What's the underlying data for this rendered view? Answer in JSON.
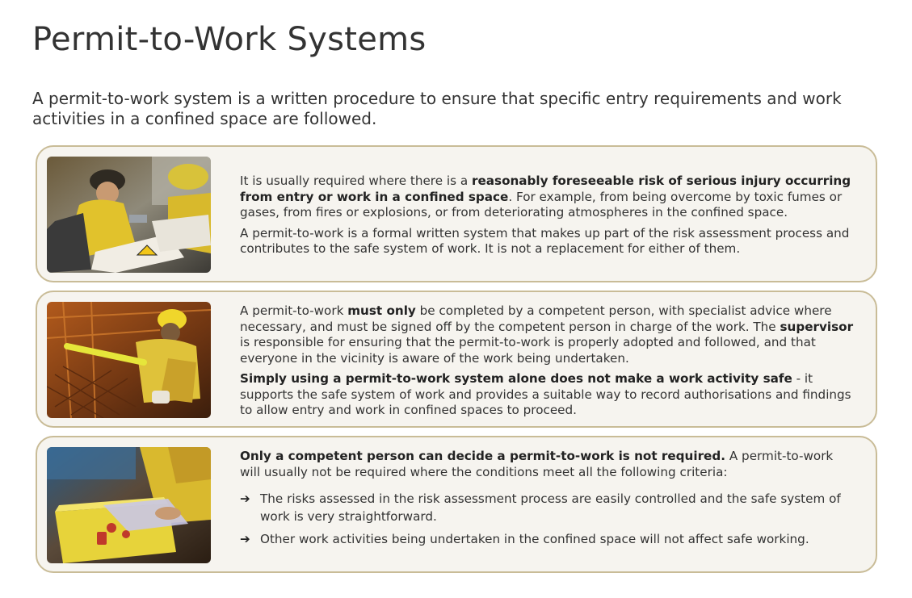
{
  "page": {
    "title": "Permit-to-Work Systems",
    "intro": "A permit-to-work system is a written procedure to ensure that specific entry requirements and work activities in a confined space are followed."
  },
  "cards": [
    {
      "image_icon": "workers-reading-documents-photo",
      "paragraphs": [
        {
          "pre": "It is usually required where there is a ",
          "bold": "reasonably foreseeable risk of serious injury occurring from entry or work in a confined space",
          "post": ". For example, from being overcome by toxic fumes or gases, from fires or explosions, or from deteriorating atmospheres in the confined space."
        },
        {
          "text": "A permit-to-work is a formal written system that makes up part of the risk assessment process and contributes to the safe system of work. It is not a replacement for either of them."
        }
      ]
    },
    {
      "image_icon": "worker-on-grating-photo",
      "paragraphs": [
        {
          "t1": "A permit-to-work ",
          "b1": "must only",
          "t2": " be completed by a competent person, with specialist advice where necessary, and must be signed off by the competent person in charge of the work. The ",
          "b2": "supervisor",
          "t3": " is responsible for ensuring that the permit-to-work is properly adopted and followed, and that everyone in the vicinity is aware of the work being undertaken."
        },
        {
          "bold": "Simply using a permit-to-work system alone does not make a work activity safe",
          "post": " - it supports the safe system of work and provides a suitable way to record authorisations and findings to allow entry and work in confined spaces to proceed."
        }
      ]
    },
    {
      "image_icon": "worker-with-lockout-box-photo",
      "lead_bold": "Only a competent person can decide a permit-to-work is not required.",
      "lead_post": " A permit-to-work will usually not be required where the conditions meet all the following criteria:",
      "arrow": "➔",
      "criteria": [
        "The risks assessed in the risk assessment process are easily controlled and the safe system of work is very straightforward.",
        "Other work activities being undertaken in the confined space will not affect safe working."
      ]
    }
  ],
  "colors": {
    "card_background": "#f6f4ef",
    "card_border": "#c9bc97",
    "text": "#333333"
  }
}
